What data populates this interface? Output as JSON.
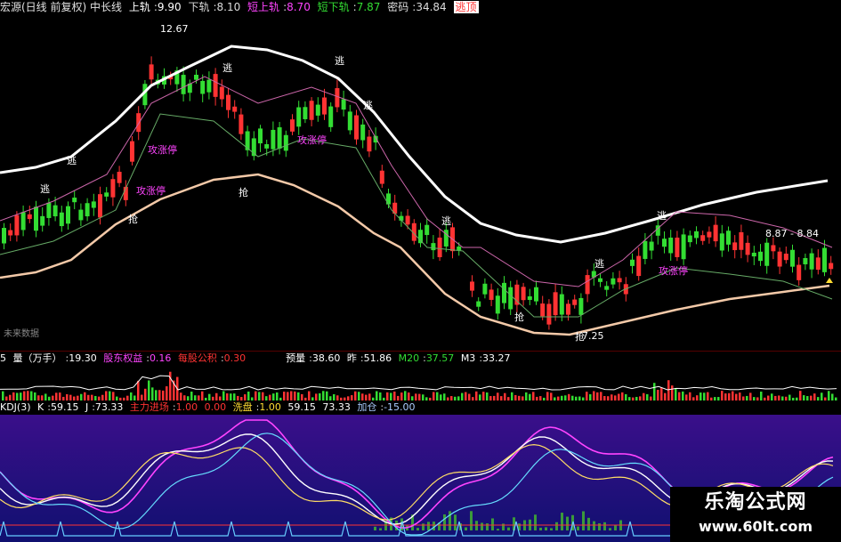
{
  "header": {
    "title": "宏源(日线 前复权) 中长线",
    "upper_label": "上轨",
    "upper_value": "9.90",
    "lower_label": "下轨",
    "lower_value": "8.10",
    "short_upper_label": "短上轨",
    "short_upper_value": "8.70",
    "short_lower_label": "短下轨",
    "short_lower_value": "7.87",
    "density_label": "密码",
    "density_value": "34.84",
    "escape_label": "逃顶"
  },
  "annotations": {
    "peak_price": "12.67",
    "low_price": "7.25",
    "range_label": "8.87 - 8.84",
    "escape": "逃",
    "grab": "抢",
    "attack": "攻涨停",
    "no_future_data": "未来数据"
  },
  "volume_panel": {
    "title": "量（万手）",
    "prefix": "5",
    "value": "19.30",
    "equity_label": "股东权益",
    "equity_value": "0.16",
    "eps_label": "每股公积",
    "eps_value": "0.30",
    "forecast_label": "预量",
    "forecast_value": "38.60",
    "yesterday_label": "昨",
    "yesterday_value": "51.86",
    "m20_label": "M20",
    "m20_value": "37.57",
    "m3_label": "M3",
    "m3_value": "33.27"
  },
  "kdj_panel": {
    "title": "KDJ(3)",
    "k_label": "K",
    "k_value": "59.15",
    "j_label": "J",
    "j_value": "73.33",
    "main_label": "主力进场",
    "main_value1": "1.00",
    "main_value2": "0.00",
    "wash_label": "洗盘",
    "wash_value": "1.00",
    "v1": "59.15",
    "v2": "73.33",
    "add_label": "加仓",
    "add_value": "-15.00"
  },
  "watermark": {
    "line1": "乐淘公式网",
    "line2": "www.60lt.com"
  },
  "colors": {
    "up": "#ff3333",
    "down": "#33dd33",
    "white_band": "#ffffff",
    "lower_band": "#f3c9a8",
    "magenta": "#ff44ff",
    "yellow": "#ffdd33",
    "kdj_bg": "#1a0f7a"
  }
}
